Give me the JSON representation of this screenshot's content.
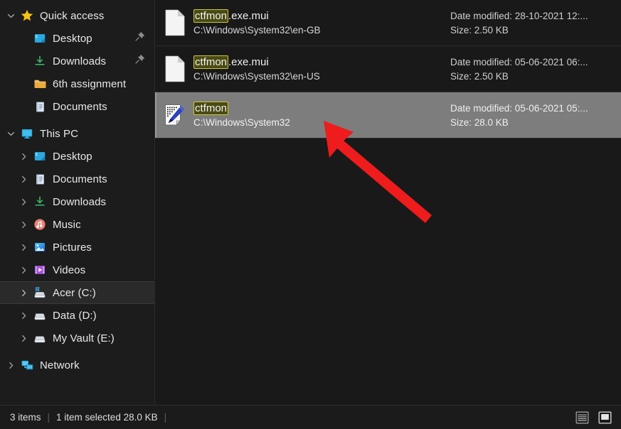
{
  "window": {
    "theme_background": "#191919",
    "selection_color": "#7d7d7d",
    "highlight_color": "#c9c93a",
    "annotation_color": "#ee1c1c"
  },
  "sidebar": {
    "groups": [
      {
        "name": "quick-access",
        "header": {
          "label": "Quick access",
          "icon": "star-icon",
          "expanded": true
        },
        "items": [
          {
            "label": "Desktop",
            "icon": "desktop-icon",
            "pinned": true,
            "has_chevron": false
          },
          {
            "label": "Downloads",
            "icon": "download-icon",
            "pinned": true,
            "has_chevron": false
          },
          {
            "label": "6th assignment",
            "icon": "folder-icon",
            "pinned": false,
            "has_chevron": false
          },
          {
            "label": "Documents",
            "icon": "documents-icon",
            "pinned": false,
            "has_chevron": false
          }
        ]
      },
      {
        "name": "this-pc",
        "header": {
          "label": "This PC",
          "icon": "pc-icon",
          "expanded": true
        },
        "items": [
          {
            "label": "Desktop",
            "icon": "desktop-icon",
            "pinned": false,
            "has_chevron": true
          },
          {
            "label": "Documents",
            "icon": "documents-icon",
            "pinned": false,
            "has_chevron": true
          },
          {
            "label": "Downloads",
            "icon": "download-icon",
            "pinned": false,
            "has_chevron": true
          },
          {
            "label": "Music",
            "icon": "music-icon",
            "pinned": false,
            "has_chevron": true
          },
          {
            "label": "Pictures",
            "icon": "pictures-icon",
            "pinned": false,
            "has_chevron": true
          },
          {
            "label": "Videos",
            "icon": "videos-icon",
            "pinned": false,
            "has_chevron": true
          },
          {
            "label": "Acer (C:)",
            "icon": "windows-drive-icon",
            "pinned": false,
            "has_chevron": true,
            "selected": true
          },
          {
            "label": "Data (D:)",
            "icon": "drive-icon",
            "pinned": false,
            "has_chevron": true
          },
          {
            "label": "My Vault (E:)",
            "icon": "drive-icon",
            "pinned": false,
            "has_chevron": true
          }
        ]
      },
      {
        "name": "network",
        "header": {
          "label": "Network",
          "icon": "network-icon",
          "expanded": false
        },
        "items": []
      }
    ]
  },
  "results": {
    "rows": [
      {
        "icon": "generic-file-icon",
        "name_highlight": "ctfmon",
        "name_rest": ".exe.mui",
        "path": "C:\\Windows\\System32\\en-GB",
        "date_modified": "Date modified: 28-10-2021 12:...",
        "size": "Size: 2.50 KB",
        "selected": false
      },
      {
        "icon": "generic-file-icon",
        "name_highlight": "ctfmon",
        "name_rest": ".exe.mui",
        "path": "C:\\Windows\\System32\\en-US",
        "date_modified": "Date modified: 05-06-2021 06:...",
        "size": "Size: 2.50 KB",
        "selected": false
      },
      {
        "icon": "ctfmon-app-icon",
        "name_highlight": "ctfmon",
        "name_rest": "",
        "path": "C:\\Windows\\System32",
        "date_modified": "Date modified: 05-06-2021 05:...",
        "size": "Size: 28.0 KB",
        "selected": true
      }
    ]
  },
  "statusbar": {
    "item_count": "3 items",
    "separator": "|",
    "selection_info": "1 item selected  28.0 KB",
    "trailing_separator": "|",
    "views": [
      {
        "name": "details-view-button",
        "label": "Details view"
      },
      {
        "name": "large-icons-view-button",
        "label": "Large icons view",
        "active": true
      }
    ]
  },
  "annotation": {
    "type": "arrow",
    "color": "#ee1c1c",
    "points_to": "selected-file-row"
  }
}
